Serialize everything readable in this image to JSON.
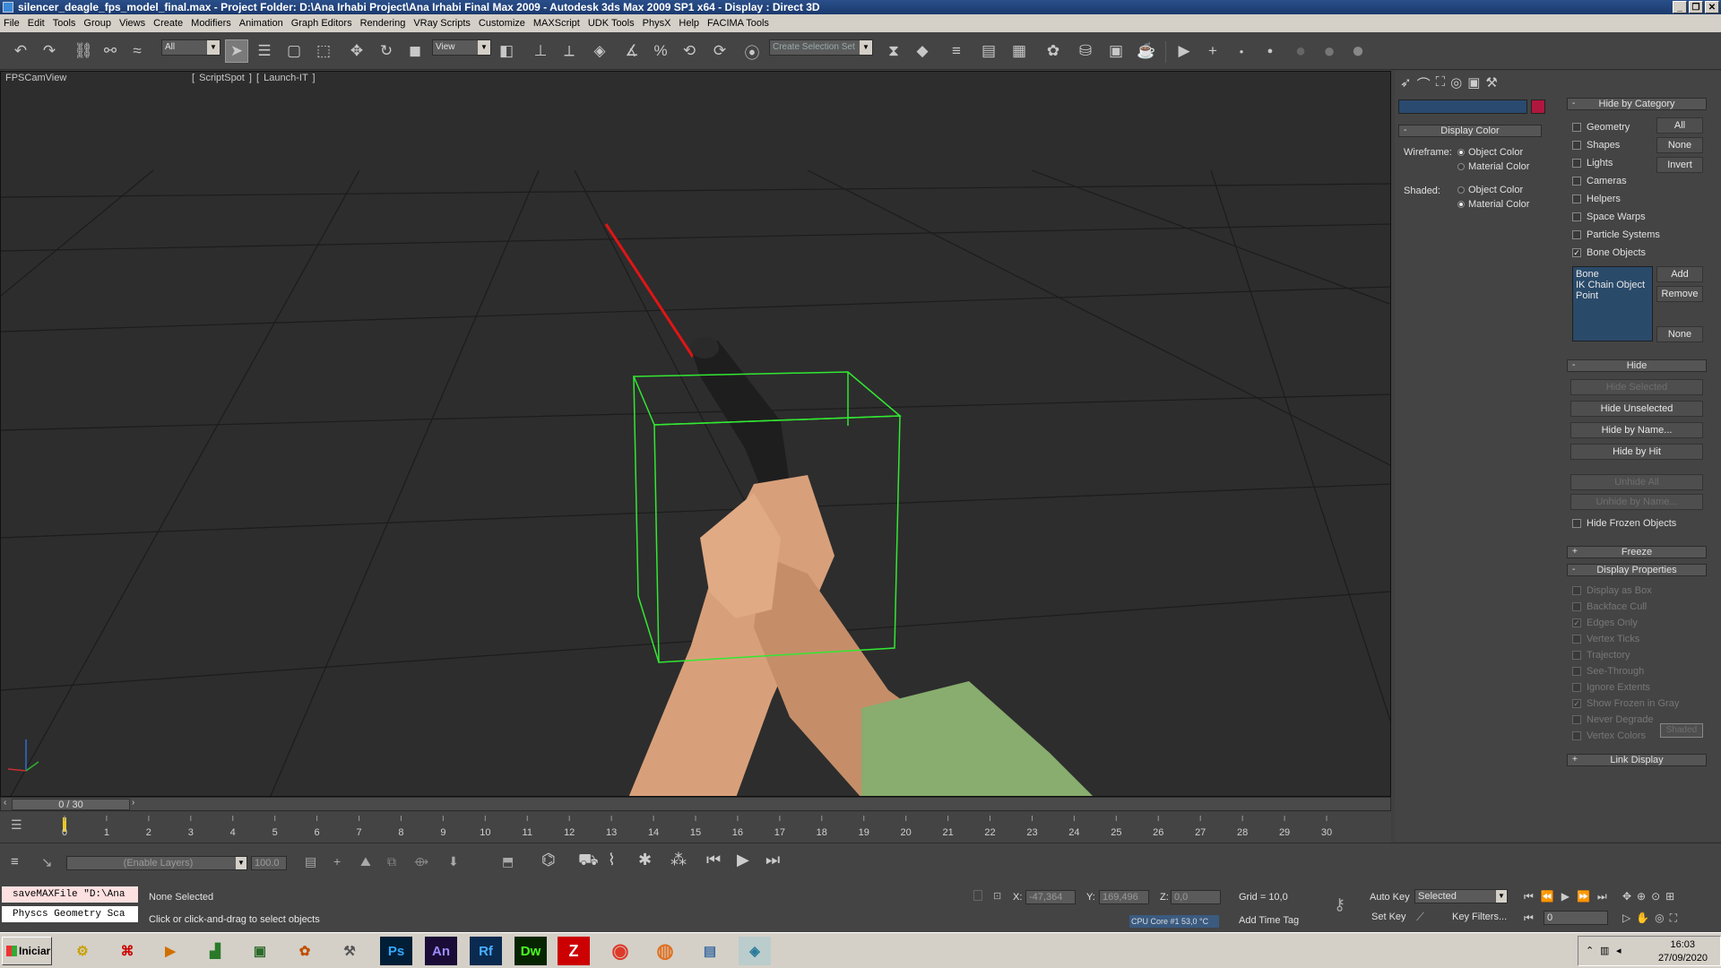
{
  "window": {
    "title": "silencer_deagle_fps_model_final.max    - Project Folder: D:\\Ana Irhabi Project\\Ana Irhabi Final Max 2009    - Autodesk 3ds Max  2009 SP1  x64    - Display : Direct 3D"
  },
  "menu": [
    "File",
    "Edit",
    "Tools",
    "Group",
    "Views",
    "Create",
    "Modifiers",
    "Animation",
    "Graph Editors",
    "Rendering",
    "VRay Scripts",
    "Customize",
    "MAXScript",
    "UDK Tools",
    "PhysX",
    "Help",
    "FACIMA Tools"
  ],
  "toolbar": {
    "selection_filter": "All",
    "ref_coord": "View",
    "named_selection": "Create Selection Set"
  },
  "viewport": {
    "label": "FPSCamView",
    "extra_tools": "[ ScriptSpot ]  [ Launch-IT ]"
  },
  "timeline": {
    "frame_display": "0 / 30",
    "ticks": [
      "0",
      "1",
      "2",
      "3",
      "4",
      "5",
      "6",
      "7",
      "8",
      "9",
      "10",
      "11",
      "12",
      "13",
      "14",
      "15",
      "16",
      "17",
      "18",
      "19",
      "20",
      "21",
      "22",
      "23",
      "24",
      "25",
      "26",
      "27",
      "28",
      "29",
      "30"
    ]
  },
  "layers": {
    "layer_placeholder": "(Enable Layers)",
    "value": "100.0"
  },
  "status": {
    "maxscript_line1": "saveMAXFile \"D:\\Ana",
    "maxscript_line2": "Physcs Geometry Sca",
    "selection": "None Selected",
    "prompt": "Click or click-and-drag to select objects",
    "x_label": "X:",
    "x_value": "-47,364",
    "y_label": "Y:",
    "y_value": "169,496",
    "z_label": "Z:",
    "z_value": "0,0",
    "grid": "Grid = 10,0",
    "cpu": "CPU Core #1    53,0 °C",
    "add_time_tag": "Add Time Tag"
  },
  "anim_controls": {
    "auto_key": "Auto Key",
    "set_key": "Set Key",
    "selected": "Selected",
    "key_filters": "Key Filters...",
    "frame": "0"
  },
  "display_color": {
    "title": "Display Color",
    "wireframe_label": "Wireframe:",
    "shaded_label": "Shaded:",
    "object_color": "Object Color",
    "material_color": "Material Color",
    "swatch_color": "#b0173e"
  },
  "hide_by_category": {
    "title": "Hide by Category",
    "items": [
      {
        "label": "Geometry",
        "checked": false
      },
      {
        "label": "Shapes",
        "checked": false
      },
      {
        "label": "Lights",
        "checked": false
      },
      {
        "label": "Cameras",
        "checked": false
      },
      {
        "label": "Helpers",
        "checked": false
      },
      {
        "label": "Space Warps",
        "checked": false
      },
      {
        "label": "Particle Systems",
        "checked": false
      },
      {
        "label": "Bone Objects",
        "checked": true
      }
    ],
    "all_btn": "All",
    "none_btn": "None",
    "invert_btn": "Invert",
    "list_items": [
      "Bone",
      "IK Chain Object",
      "Point"
    ],
    "add_btn": "Add",
    "remove_btn": "Remove",
    "none2_btn": "None"
  },
  "hide": {
    "title": "Hide",
    "hide_selected": "Hide Selected",
    "hide_unselected": "Hide Unselected",
    "hide_by_name": "Hide by Name...",
    "hide_by_hit": "Hide by Hit",
    "unhide_all": "Unhide All",
    "unhide_by_name": "Unhide by Name...",
    "hide_frozen": "Hide Frozen Objects"
  },
  "freeze": {
    "title": "Freeze"
  },
  "display_properties": {
    "title": "Display Properties",
    "items": [
      {
        "label": "Display as Box",
        "checked": false
      },
      {
        "label": "Backface Cull",
        "checked": false
      },
      {
        "label": "Edges Only",
        "checked": true
      },
      {
        "label": "Vertex Ticks",
        "checked": false
      },
      {
        "label": "Trajectory",
        "checked": false
      },
      {
        "label": "See-Through",
        "checked": false
      },
      {
        "label": "Ignore Extents",
        "checked": false
      },
      {
        "label": "Show Frozen in Gray",
        "checked": true
      },
      {
        "label": "Never Degrade",
        "checked": false
      },
      {
        "label": "Vertex Colors",
        "checked": false
      }
    ],
    "shaded_btn": "Shaded"
  },
  "link_display": {
    "title": "Link Display"
  },
  "taskbar": {
    "start": "Iniciar",
    "apps": [
      "Ps",
      "An",
      "Rf",
      "Dw"
    ],
    "time": "16:03",
    "date": "27/09/2020"
  }
}
